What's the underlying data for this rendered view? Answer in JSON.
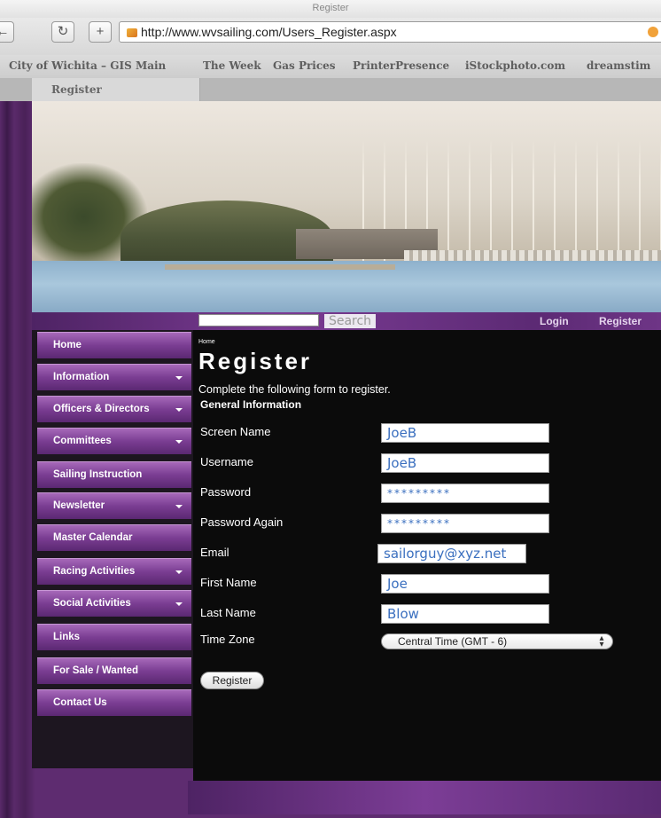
{
  "browser": {
    "window_title": "Register",
    "url": "http://www.wvsailing.com/Users_Register.aspx",
    "tab_label": "Register",
    "bookmarks": [
      "City of Wichita – GIS Main",
      "The Week",
      "Gas Prices",
      "PrinterPresence",
      "iStockphoto.com",
      "dreamstim"
    ]
  },
  "utility": {
    "search_placeholder": "",
    "search_label": "Search",
    "login_label": "Login",
    "register_label": "Register"
  },
  "sidenav": {
    "items": [
      {
        "label": "Home",
        "has_menu": false
      },
      {
        "label": "Information",
        "has_menu": true
      },
      {
        "label": "Officers & Directors",
        "has_menu": true
      },
      {
        "label": "Committees",
        "has_menu": true
      },
      {
        "label": "Sailing Instruction",
        "has_menu": false
      },
      {
        "label": "Newsletter",
        "has_menu": true
      },
      {
        "label": "Master Calendar",
        "has_menu": false
      },
      {
        "label": "Racing Activities",
        "has_menu": true
      },
      {
        "label": "Social Activities",
        "has_menu": true
      },
      {
        "label": "Links",
        "has_menu": false
      },
      {
        "label": "For Sale / Wanted",
        "has_menu": false
      },
      {
        "label": "Contact Us",
        "has_menu": false
      }
    ]
  },
  "page": {
    "breadcrumb": "Home",
    "title": "Register",
    "subtitle": "Complete the following form to register.",
    "section": "General Information"
  },
  "form": {
    "fields": [
      {
        "label": "Screen Name",
        "value": "JoeB"
      },
      {
        "label": "Username",
        "value": "JoeB"
      },
      {
        "label": "Password",
        "value": "*********"
      },
      {
        "label": "Password Again",
        "value": "*********"
      },
      {
        "label": "Email",
        "value": "sailorguy@xyz.net"
      },
      {
        "label": "First Name",
        "value": "Joe"
      },
      {
        "label": "Last Name",
        "value": "Blow"
      }
    ],
    "timezone_label": "Time Zone",
    "timezone_value": "Central Time (GMT - 6)",
    "submit_label": "Register"
  },
  "colors": {
    "nav_purple": "#7a3d92",
    "input_text_blue": "#3a6fbf",
    "background": "#0b0b0b"
  }
}
